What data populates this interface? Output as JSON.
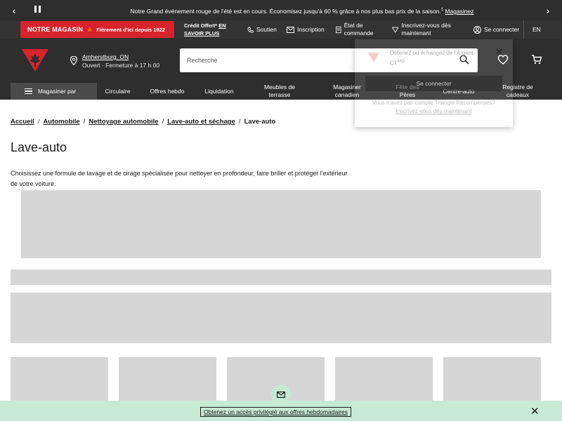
{
  "promo": {
    "message": "Notre Grand événement rouge de l'été est en cours. Économisez jusqu'à 60 % grâce à nos plus bas prix de la saison.",
    "superscript": "‡",
    "link": "Magasinez"
  },
  "util": {
    "brand_name": "NOTRE MAGASIN",
    "brand_tagline": "Fièrement d'ici depuis 1922",
    "credit_text": "Crédit Offert*",
    "credit_link": "EN SAVOIR PLUS",
    "support": "Soutien",
    "signup": "Inscription",
    "order_status": "État de commande",
    "register": "Inscrivez-vous dès maintenant",
    "signin": "Se connecter",
    "language": "EN"
  },
  "header": {
    "store_name": "Amherstburg, ON",
    "store_status": "Ouvert",
    "store_hours": "· Fermeture à 17 h 00",
    "search_placeholder": "Recherche"
  },
  "nav": {
    "shop": "Magasiner par",
    "items": [
      "Circulaire",
      "Offres hebdo",
      "Liquidation",
      "Meubles de terrasse",
      "Magasiner canadien",
      "Fête des Pères",
      "Centre-auto",
      "Registre de cadeaux"
    ]
  },
  "signin_popup": {
    "line1": "Obtenez ou échangez de l'Argent CT",
    "line1_sup": "MD",
    "button": "Se connecter",
    "line2": "Vous n'avez pas compte Triangle Récompenses?",
    "line2_link": "Inscrivez-vous dès maintenant"
  },
  "breadcrumb": [
    "Accueil",
    "Automobile",
    "Nettoyage automobile",
    "Lave-auto et séchage",
    "Lave-auto"
  ],
  "page": {
    "title": "Lave-auto",
    "description": "Choisissez une formule de lavage et de cirage spécialisée pour nettoyer en profondeur, faire briller et protéger l'extérieur de votre voiture."
  },
  "banner": {
    "link_text": "Obtenez un accès privilégié aux offres hebdomadaires"
  },
  "colors": {
    "brand_red": "#d6232c",
    "header_bg": "#2e2e2e",
    "banner_green": "#c7e9d5",
    "skeleton": "#d6d6d6"
  }
}
